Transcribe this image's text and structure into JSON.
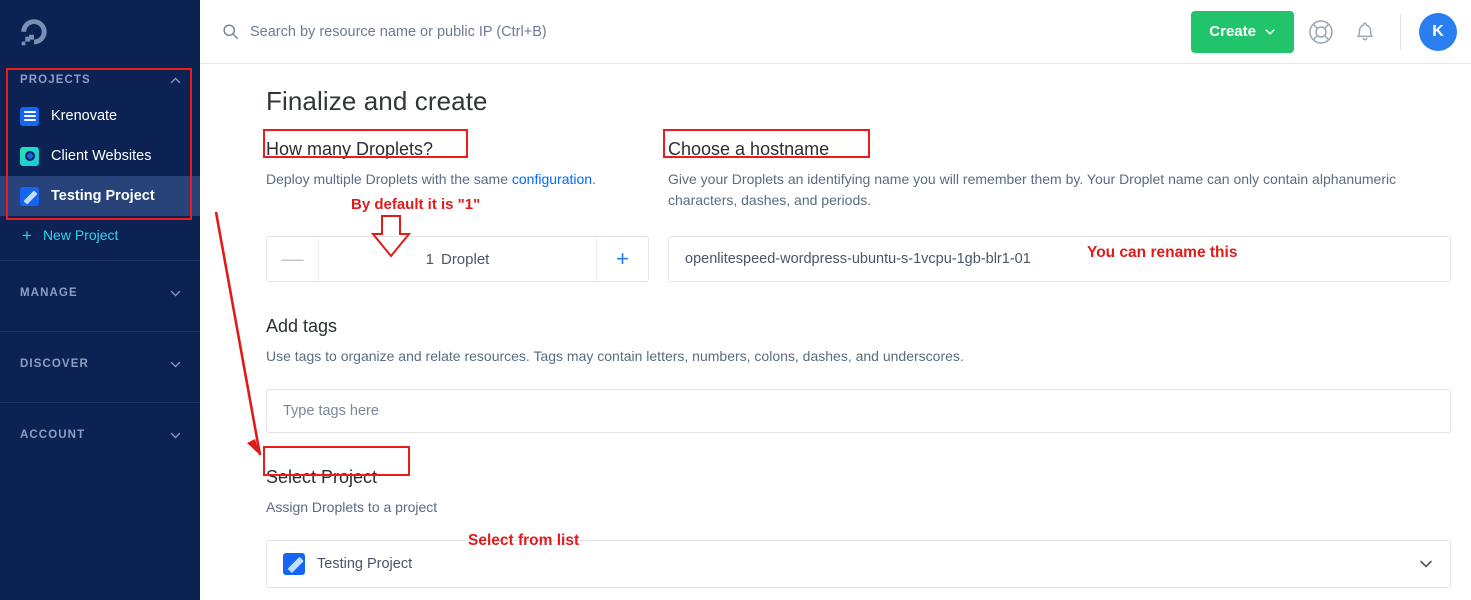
{
  "sidebar": {
    "logo_name": "digitalocean-logo",
    "projects_header": "PROJECTS",
    "projects": [
      {
        "label": "Krenovate",
        "icon": "list-icon",
        "active": false
      },
      {
        "label": "Client Websites",
        "icon": "circle-icon",
        "active": false
      },
      {
        "label": "Testing Project",
        "icon": "pencil-icon",
        "active": true
      }
    ],
    "new_project_label": "New Project",
    "sections": [
      "MANAGE",
      "DISCOVER",
      "ACCOUNT"
    ]
  },
  "header": {
    "search_placeholder": "Search by resource name or public IP (Ctrl+B)",
    "search_value": "",
    "create_label": "Create",
    "help_icon": "lifering-icon",
    "bell_icon": "bell-icon",
    "avatar_initial": "K"
  },
  "main": {
    "page_title": "Finalize and create",
    "droplets": {
      "title": "How many Droplets?",
      "desc_before": "Deploy multiple Droplets with the same ",
      "desc_link": "configuration",
      "desc_after": ".",
      "count": "1",
      "unit": "Droplet",
      "minus_label": "—",
      "plus_label": "+"
    },
    "hostname": {
      "title": "Choose a hostname",
      "desc": "Give your Droplets an identifying name you will remember them by. Your Droplet name can only contain alphanumeric characters, dashes, and periods.",
      "value": "openlitespeed-wordpress-ubuntu-s-1vcpu-1gb-blr1-01"
    },
    "tags": {
      "title": "Add tags",
      "desc": "Use tags to organize and relate resources. Tags may contain letters, numbers, colons, dashes, and underscores.",
      "placeholder": "Type tags here",
      "value": ""
    },
    "project": {
      "title": "Select Project",
      "desc": "Assign Droplets to a project",
      "selected": "Testing Project"
    }
  },
  "annotations": {
    "default_one": "By default it is \"1\"",
    "rename_this": "You can rename this",
    "select_from_list": "Select from list"
  },
  "colors": {
    "sidebar_bg": "#0b2253",
    "sidebar_active": "#28437a",
    "accent_green": "#22c46b",
    "link_blue": "#0069ff",
    "annotation_red": "#ee1b1b",
    "cyan": "#34d1ea"
  }
}
